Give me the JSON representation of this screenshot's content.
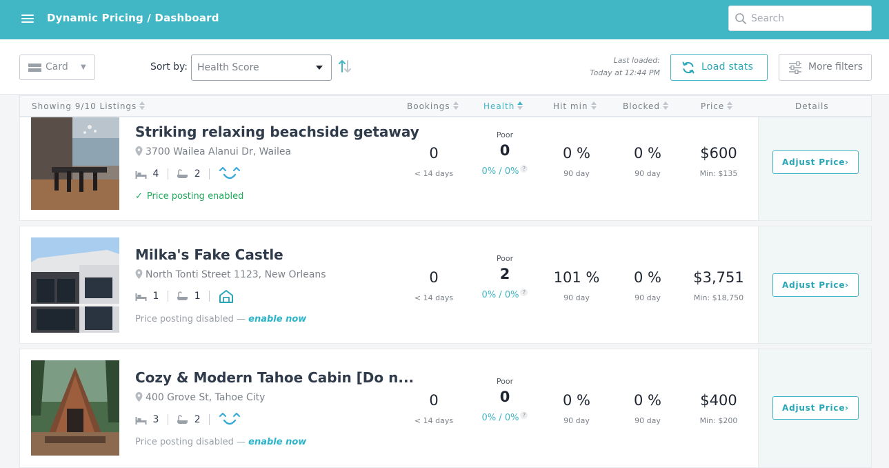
{
  "header": {
    "title": "Dynamic Pricing / Dashboard",
    "search_placeholder": "Search"
  },
  "toolbar": {
    "view_label": "Card",
    "sort_by_label": "Sort by:",
    "sort_value": "Health Score",
    "last_loaded_label": "Last loaded:",
    "last_loaded_time": "Today at 12:44 PM",
    "load_stats_label": "Load stats",
    "more_filters_label": "More filters"
  },
  "columns": {
    "showing": "Showing 9/10 Listings",
    "bookings": "Bookings",
    "health": "Health",
    "hit_min": "Hit min",
    "blocked": "Blocked",
    "price": "Price",
    "details": "Details"
  },
  "listings": [
    {
      "title": "Striking relaxing beachside getaway",
      "address": "3700 Wailea Alanui Dr, Wailea",
      "beds": "4",
      "baths": "2",
      "channel_icon": "smile-channel-icon",
      "posting_status": "Price posting enabled",
      "posting_enabled": true,
      "bookings": "0",
      "bookings_sub": "< 14 days",
      "health_label": "Poor",
      "health": "0",
      "health_sub": "0% / 0%",
      "hit_min": "0 %",
      "hit_min_sub": "90 day",
      "blocked": "0 %",
      "blocked_sub": "90 day",
      "price": "$600",
      "price_min": "Min: $135",
      "adjust_label": "Adjust Price"
    },
    {
      "title": "Milka's Fake Castle",
      "address": "North Tonti Street 1123, New Orleans",
      "beds": "1",
      "baths": "1",
      "channel_icon": "home-channel-icon",
      "posting_status": "Price posting disabled —",
      "posting_link": "enable now",
      "posting_enabled": false,
      "bookings": "0",
      "bookings_sub": "< 14 days",
      "health_label": "Poor",
      "health": "2",
      "health_sub": "0% / 0%",
      "hit_min": "101 %",
      "hit_min_sub": "90 day",
      "blocked": "0 %",
      "blocked_sub": "90 day",
      "price": "$3,751",
      "price_min": "Min: $18,750",
      "adjust_label": "Adjust Price"
    },
    {
      "title": "Cozy & Modern Tahoe Cabin [Do n...",
      "address": "400 Grove St, Tahoe City",
      "beds": "3",
      "baths": "2",
      "channel_icon": "smile-channel-icon",
      "posting_status": "Price posting disabled —",
      "posting_link": "enable now",
      "posting_enabled": false,
      "bookings": "0",
      "bookings_sub": "< 14 days",
      "health_label": "Poor",
      "health": "0",
      "health_sub": "0% / 0%",
      "hit_min": "0 %",
      "hit_min_sub": "90 day",
      "blocked": "0 %",
      "blocked_sub": "90 day",
      "price": "$400",
      "price_min": "Min: $200",
      "adjust_label": "Adjust Price"
    }
  ],
  "colors": {
    "brand": "#41b6c4",
    "enabled_green": "#23a85a",
    "link": "#2bb3c9"
  }
}
